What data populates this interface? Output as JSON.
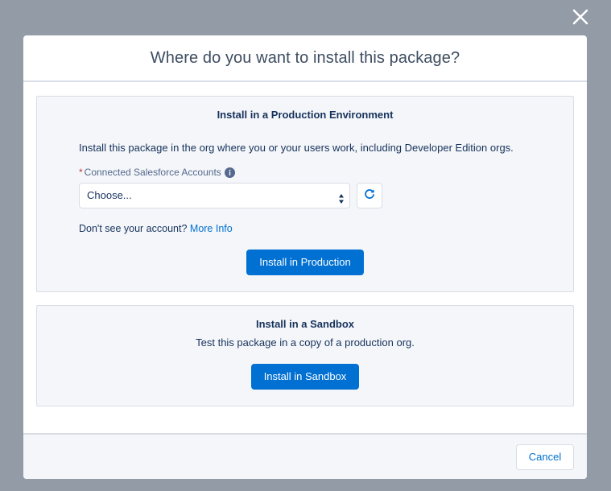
{
  "modal": {
    "title": "Where do you want to install this package?"
  },
  "production": {
    "heading": "Install in a Production Environment",
    "description": "Install this package in the org where you or your users work, including Developer Edition orgs.",
    "field_required_marker": "*",
    "field_label": "Connected Salesforce Accounts",
    "select_value": "Choose...",
    "help_prefix": "Don't see your account?",
    "help_link": "More Info",
    "install_button": "Install in Production"
  },
  "sandbox": {
    "heading": "Install in a Sandbox",
    "description": "Test this package in a copy of a production org.",
    "install_button": "Install in Sandbox"
  },
  "footer": {
    "cancel_label": "Cancel"
  },
  "icons": {
    "close": "close-icon",
    "info": "info-icon",
    "refresh": "refresh-icon",
    "select_arrows": "updown-arrows-icon"
  },
  "colors": {
    "backdrop": "#929ba6",
    "brand": "#0070d2",
    "required": "#c23934",
    "text": "#16325c"
  }
}
